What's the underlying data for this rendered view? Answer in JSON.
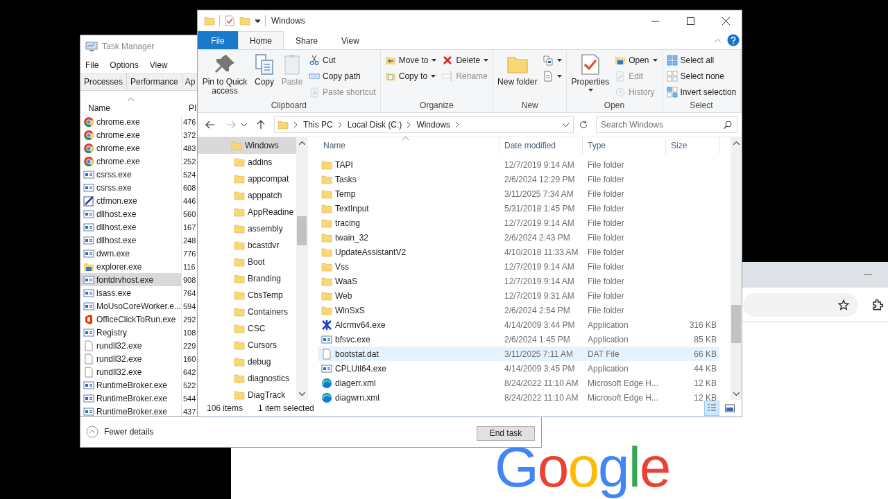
{
  "task_manager": {
    "title": "Task Manager",
    "menu": [
      "File",
      "Options",
      "View"
    ],
    "tabs": [
      {
        "label": "Processes",
        "selected": false
      },
      {
        "label": "Performance",
        "selected": false
      },
      {
        "label": "Ap",
        "selected": false
      }
    ],
    "columns": [
      "Name",
      "PI"
    ],
    "processes": [
      {
        "name": "chrome.exe",
        "pid": "476",
        "kind": "chrome",
        "selected": false
      },
      {
        "name": "chrome.exe",
        "pid": "372",
        "kind": "chrome",
        "selected": false
      },
      {
        "name": "chrome.exe",
        "pid": "483",
        "kind": "chrome",
        "selected": false
      },
      {
        "name": "chrome.exe",
        "pid": "252",
        "kind": "chrome",
        "selected": false
      },
      {
        "name": "csrss.exe",
        "pid": "524",
        "kind": "app",
        "selected": false
      },
      {
        "name": "csrss.exe",
        "pid": "608",
        "kind": "app",
        "selected": false
      },
      {
        "name": "ctfmon.exe",
        "pid": "446",
        "kind": "pen",
        "selected": false
      },
      {
        "name": "dllhost.exe",
        "pid": "560",
        "kind": "app",
        "selected": false
      },
      {
        "name": "dllhost.exe",
        "pid": "167",
        "kind": "app",
        "selected": false
      },
      {
        "name": "dllhost.exe",
        "pid": "248",
        "kind": "app",
        "selected": false
      },
      {
        "name": "dwm.exe",
        "pid": "776",
        "kind": "app",
        "selected": false
      },
      {
        "name": "explorer.exe",
        "pid": "116",
        "kind": "explorer",
        "selected": false
      },
      {
        "name": "fontdrvhost.exe",
        "pid": "908",
        "kind": "app",
        "selected": true
      },
      {
        "name": "lsass.exe",
        "pid": "764",
        "kind": "app",
        "selected": false
      },
      {
        "name": "MoUsoCoreWorker.e...",
        "pid": "594",
        "kind": "app",
        "selected": false
      },
      {
        "name": "OfficeClickToRun.exe",
        "pid": "292",
        "kind": "office",
        "selected": false
      },
      {
        "name": "Registry",
        "pid": "108",
        "kind": "app",
        "selected": false
      },
      {
        "name": "rundll32.exe",
        "pid": "229",
        "kind": "file",
        "selected": false
      },
      {
        "name": "rundll32.exe",
        "pid": "160",
        "kind": "file",
        "selected": false
      },
      {
        "name": "rundll32.exe",
        "pid": "642",
        "kind": "file",
        "selected": false
      },
      {
        "name": "RuntimeBroker.exe",
        "pid": "522",
        "kind": "app",
        "selected": false
      },
      {
        "name": "RuntimeBroker.exe",
        "pid": "544",
        "kind": "app",
        "selected": false
      },
      {
        "name": "RuntimeBroker.exe",
        "pid": "437",
        "kind": "app",
        "selected": false
      }
    ],
    "fewer_details": "Fewer details",
    "end_task": "End task"
  },
  "explorer": {
    "title": "Windows",
    "ribbon_tabs": [
      {
        "label": "File",
        "kind": "menu",
        "selected": false
      },
      {
        "label": "Home",
        "kind": "tab",
        "selected": true
      },
      {
        "label": "Share",
        "kind": "tab",
        "selected": false
      },
      {
        "label": "View",
        "kind": "tab",
        "selected": false
      }
    ],
    "ribbon_groups": [
      {
        "label": "Clipboard",
        "items": [
          {
            "kind": "large",
            "label": "Pin to Quick access",
            "disabled": false,
            "dropdown": false
          },
          {
            "kind": "large",
            "label": "Copy",
            "disabled": false,
            "dropdown": false
          },
          {
            "kind": "large",
            "label": "Paste",
            "disabled": true,
            "dropdown": false
          },
          {
            "kind": "stack",
            "commands": [
              {
                "label": "Cut",
                "disabled": false,
                "dropdown": false
              },
              {
                "label": "Copy path",
                "disabled": false,
                "dropdown": false
              },
              {
                "label": "Paste shortcut",
                "disabled": true,
                "dropdown": false
              }
            ]
          }
        ]
      },
      {
        "label": "Organize",
        "items": [
          {
            "kind": "stack",
            "commands": [
              {
                "label": "Move to",
                "disabled": false,
                "dropdown": true
              },
              {
                "label": "Copy to",
                "disabled": false,
                "dropdown": true
              }
            ]
          },
          {
            "kind": "stack",
            "commands": [
              {
                "label": "Delete",
                "disabled": false,
                "dropdown": true
              },
              {
                "label": "Rename",
                "disabled": true,
                "dropdown": false
              }
            ]
          }
        ]
      },
      {
        "label": "New",
        "items": [
          {
            "kind": "large",
            "label": "New folder",
            "disabled": false,
            "dropdown": false
          },
          {
            "kind": "stack",
            "commands": [
              {
                "disabled": false,
                "dropdown": true
              },
              {
                "disabled": false,
                "dropdown": true
              }
            ]
          }
        ]
      },
      {
        "label": "Open",
        "items": [
          {
            "kind": "large",
            "label": "Properties",
            "disabled": false,
            "dropdown": true
          },
          {
            "kind": "stack",
            "commands": [
              {
                "label": "Open",
                "disabled": false,
                "dropdown": true
              },
              {
                "label": "Edit",
                "disabled": true,
                "dropdown": false
              },
              {
                "label": "History",
                "disabled": true,
                "dropdown": false
              }
            ]
          }
        ]
      },
      {
        "label": "Select",
        "items": [
          {
            "kind": "stack",
            "commands": [
              {
                "label": "Select all",
                "disabled": false,
                "dropdown": false
              },
              {
                "label": "Select none",
                "disabled": false,
                "dropdown": false
              },
              {
                "label": "Invert selection",
                "disabled": false,
                "dropdown": false
              }
            ]
          }
        ]
      }
    ],
    "address": {
      "crumbs": [
        "This PC",
        "Local Disk (C:)",
        "Windows"
      ],
      "search_placeholder": "Search Windows"
    },
    "nav_tree": [
      {
        "label": "Windows",
        "selected": true,
        "children": [
          {
            "label": "addins",
            "selected": false
          },
          {
            "label": "appcompat",
            "selected": false
          },
          {
            "label": "apppatch",
            "selected": false
          },
          {
            "label": "AppReadine",
            "selected": false
          },
          {
            "label": "assembly",
            "selected": false
          },
          {
            "label": "bcastdvr",
            "selected": false
          },
          {
            "label": "Boot",
            "selected": false
          },
          {
            "label": "Branding",
            "selected": false
          },
          {
            "label": "CbsTemp",
            "selected": false
          },
          {
            "label": "Containers",
            "selected": false
          },
          {
            "label": "CSC",
            "selected": false
          },
          {
            "label": "Cursors",
            "selected": false
          },
          {
            "label": "debug",
            "selected": false
          },
          {
            "label": "diagnostics",
            "selected": false
          },
          {
            "label": "DiagTrack",
            "selected": false
          }
        ]
      }
    ],
    "columns": [
      "Name",
      "Date modified",
      "Type",
      "Size"
    ],
    "files": [
      {
        "name": "TAPI",
        "date": "12/7/2019 9:14 AM",
        "type": "File folder",
        "kind": "folder",
        "selected": false
      },
      {
        "name": "Tasks",
        "date": "2/6/2024 12:29 PM",
        "type": "File folder",
        "kind": "folder",
        "selected": false
      },
      {
        "name": "Temp",
        "date": "3/11/2025 7:34 AM",
        "type": "File folder",
        "kind": "folder",
        "selected": false
      },
      {
        "name": "TextInput",
        "date": "5/31/2018 1:45 PM",
        "type": "File folder",
        "kind": "folder",
        "selected": false
      },
      {
        "name": "tracing",
        "date": "12/7/2019 9:14 AM",
        "type": "File folder",
        "kind": "folder",
        "selected": false
      },
      {
        "name": "twain_32",
        "date": "2/6/2024 2:43 PM",
        "type": "File folder",
        "kind": "folder",
        "selected": false
      },
      {
        "name": "UpdateAssistantV2",
        "date": "4/10/2018 11:33 AM",
        "type": "File folder",
        "kind": "folder",
        "selected": false
      },
      {
        "name": "Vss",
        "date": "12/7/2019 9:14 AM",
        "type": "File folder",
        "kind": "folder",
        "selected": false
      },
      {
        "name": "WaaS",
        "date": "12/7/2019 9:14 AM",
        "type": "File folder",
        "kind": "folder",
        "selected": false
      },
      {
        "name": "Web",
        "date": "12/7/2019 9:31 AM",
        "type": "File folder",
        "kind": "folder",
        "selected": false
      },
      {
        "name": "WinSxS",
        "date": "2/6/2024 2:54 PM",
        "type": "File folder",
        "kind": "folder",
        "selected": false
      },
      {
        "name": "Alcrmv64.exe",
        "date": "4/14/2009 3:44 PM",
        "type": "Application",
        "size": "316 KB",
        "kind": "cross",
        "selected": false
      },
      {
        "name": "bfsvc.exe",
        "date": "2/6/2024 1:45 PM",
        "type": "Application",
        "size": "85 KB",
        "kind": "app",
        "selected": false
      },
      {
        "name": "bootstat.dat",
        "date": "3/11/2025 7:11 AM",
        "type": "DAT File",
        "size": "66 KB",
        "kind": "file",
        "selected": true
      },
      {
        "name": "CPLUtl64.exe",
        "date": "4/14/2009 3:45 PM",
        "type": "Application",
        "size": "44 KB",
        "kind": "app",
        "selected": false
      },
      {
        "name": "diagerr.xml",
        "date": "8/24/2022 11:10 AM",
        "type": "Microsoft Edge H...",
        "size": "12 KB",
        "kind": "edge",
        "selected": false
      },
      {
        "name": "diagwrn.xml",
        "date": "8/24/2022 11:10 AM",
        "type": "Microsoft Edge H...",
        "size": "12 KB",
        "kind": "edge",
        "selected": false
      }
    ],
    "status": {
      "item_count": "106 items",
      "selection": "1 item selected"
    },
    "view_buttons": [
      {
        "kind": "details",
        "selected": true
      },
      {
        "kind": "large-icons",
        "selected": false
      }
    ]
  },
  "browser": {
    "logo": "Google"
  }
}
